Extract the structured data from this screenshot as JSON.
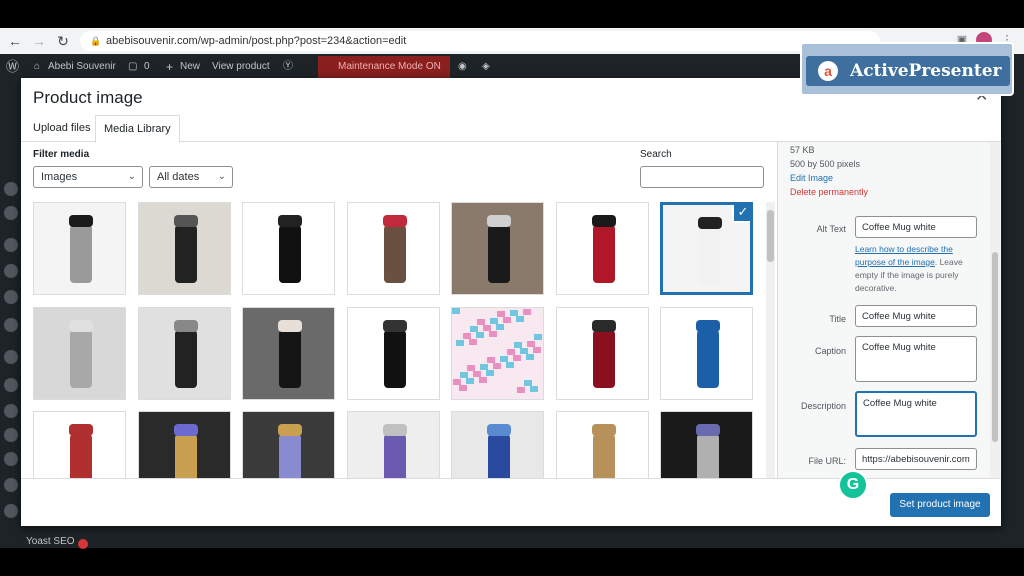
{
  "browser": {
    "url": "abebisouvenir.com/wp-admin/post.php?post=234&action=edit"
  },
  "admin_bar": {
    "site_name": "Abebi Souvenir",
    "comments_count": "0",
    "new_label": "New",
    "view_label": "View product",
    "maintenance_label": "Maintenance Mode ON"
  },
  "overlay": {
    "brand": "ActivePresenter"
  },
  "modal": {
    "title": "Product image",
    "tabs": [
      {
        "label": "Upload files"
      },
      {
        "label": "Media Library"
      }
    ],
    "filter_label": "Filter media",
    "filter_type": "Images",
    "filter_date": "All dates",
    "search_label": "Search",
    "search_value": "",
    "set_button": "Set product image"
  },
  "details": {
    "file_size": "57 KB",
    "dimensions": "500 by 500 pixels",
    "edit_link": "Edit Image",
    "delete_link": "Delete permanently",
    "alt_label": "Alt Text",
    "alt_value": "Coffee Mug white",
    "alt_help_link": "Learn how to describe the purpose of the image",
    "alt_help_rest": ". Leave empty if the image is purely decorative.",
    "title_label": "Title",
    "title_value": "Coffee Mug white",
    "caption_label": "Caption",
    "caption_value": "Coffee Mug white",
    "description_label": "Description",
    "description_value": "Coffee Mug white",
    "url_label": "File URL:",
    "url_value": "https://abebisouvenir.com"
  },
  "sidebar_footer": {
    "yoast_label": "Yoast SEO"
  },
  "colors": {
    "accent": "#2271b1",
    "danger": "#d63638",
    "admin_bar": "#1d2327"
  },
  "thumbnails": [
    {
      "bg": "#f4f4f4",
      "obj": "#9a9a9a",
      "cap": "#1a1a1a"
    },
    {
      "bg": "#dcd8d2",
      "obj": "#222222",
      "cap": "#555555"
    },
    {
      "bg": "#ffffff",
      "obj": "#111111",
      "cap": "#222222"
    },
    {
      "bg": "#ffffff",
      "obj": "#6a5040",
      "cap": "#c02a3a"
    },
    {
      "bg": "#8a7a6c",
      "obj": "#1a1a1a",
      "cap": "#d0d0d0"
    },
    {
      "bg": "#ffffff",
      "obj": "#b0182a",
      "cap": "#1a1a1a"
    },
    {
      "bg": "#f4f4f4",
      "obj": "#f2f2f2",
      "cap": "#222222",
      "selected": true
    },
    {
      "bg": "#d8d8d8",
      "obj": "#a8a8a8",
      "cap": "#e0e0e0"
    },
    {
      "bg": "#e0e0e0",
      "obj": "#222222",
      "cap": "#888888"
    },
    {
      "bg": "#6a6a6a",
      "obj": "#151515",
      "cap": "#e8e0d8"
    },
    {
      "bg": "#ffffff",
      "obj": "#111111",
      "cap": "#333333"
    },
    {
      "bg": "#f8e8f0",
      "obj": "#e890c0",
      "cap": "#70c8e0",
      "pattern": true
    },
    {
      "bg": "#ffffff",
      "obj": "#8a1020",
      "cap": "#2a2a2a"
    },
    {
      "bg": "#ffffff",
      "obj": "#1a5fa8",
      "cap": "#1a5fa8"
    },
    {
      "bg": "#ffffff",
      "obj": "#b03030",
      "cap": "#b03030"
    },
    {
      "bg": "#2a2a2a",
      "obj": "#c8a050",
      "cap": "#6a6ad0"
    },
    {
      "bg": "#3a3a3a",
      "obj": "#8a8ad0",
      "cap": "#c8a050"
    },
    {
      "bg": "#eeeeee",
      "obj": "#6a5ab0",
      "cap": "#c0c0c0"
    },
    {
      "bg": "#e8e8e8",
      "obj": "#2a4aa0",
      "cap": "#5a8ad0"
    },
    {
      "bg": "#ffffff",
      "obj": "#b8905a",
      "cap": "#b8905a"
    },
    {
      "bg": "#1a1a1a",
      "obj": "#b0b0b0",
      "cap": "#6a6ab0"
    }
  ]
}
